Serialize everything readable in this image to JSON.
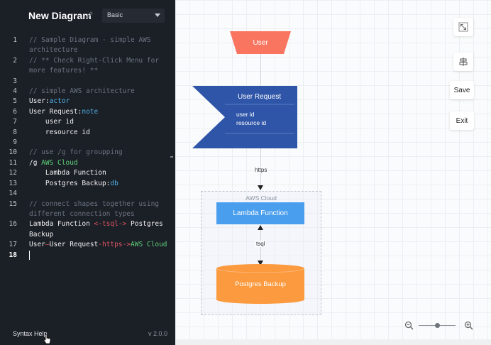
{
  "editor": {
    "title": "New Diagram",
    "theme_select": {
      "selected": "Basic"
    },
    "lines": [
      {
        "n": "1",
        "segments": [
          {
            "t": "// Sample Diagram - simple AWS",
            "c": "comment"
          }
        ]
      },
      {
        "n": "",
        "segments": [
          {
            "t": "architecture",
            "c": "comment"
          }
        ]
      },
      {
        "n": "2",
        "segments": [
          {
            "t": "// ** Check Right-Click Menu for",
            "c": "comment"
          }
        ]
      },
      {
        "n": "",
        "segments": [
          {
            "t": "more features! **",
            "c": "comment"
          }
        ]
      },
      {
        "n": "3",
        "segments": []
      },
      {
        "n": "4",
        "segments": [
          {
            "t": "// simple AWS architecture",
            "c": "comment"
          }
        ]
      },
      {
        "n": "5",
        "segments": [
          {
            "t": "User:",
            "c": ""
          },
          {
            "t": "actor",
            "c": "type"
          }
        ]
      },
      {
        "n": "6",
        "segments": [
          {
            "t": "User Request:",
            "c": ""
          },
          {
            "t": "note",
            "c": "type"
          }
        ]
      },
      {
        "n": "7",
        "segments": [
          {
            "t": "    user id",
            "c": ""
          }
        ]
      },
      {
        "n": "8",
        "segments": [
          {
            "t": "    resource id",
            "c": ""
          }
        ]
      },
      {
        "n": "9",
        "segments": []
      },
      {
        "n": "10",
        "segments": [
          {
            "t": "// use /g for groupping",
            "c": "comment"
          }
        ]
      },
      {
        "n": "11",
        "segments": [
          {
            "t": "/g ",
            "c": ""
          },
          {
            "t": "AWS Cloud",
            "c": "group"
          }
        ]
      },
      {
        "n": "12",
        "segments": [
          {
            "t": "    Lambda Function",
            "c": ""
          }
        ]
      },
      {
        "n": "13",
        "segments": [
          {
            "t": "    Postgres Backup:",
            "c": ""
          },
          {
            "t": "db",
            "c": "type"
          }
        ]
      },
      {
        "n": "14",
        "segments": []
      },
      {
        "n": "15",
        "segments": [
          {
            "t": "// connect shapes together using",
            "c": "comment"
          }
        ]
      },
      {
        "n": "",
        "segments": [
          {
            "t": "different connection types",
            "c": "comment"
          }
        ]
      },
      {
        "n": "16",
        "segments": [
          {
            "t": "Lambda Function ",
            "c": ""
          },
          {
            "t": "<-tsql->",
            "c": "arrow"
          },
          {
            "t": " Postgres",
            "c": ""
          }
        ]
      },
      {
        "n": "",
        "segments": [
          {
            "t": "Backup",
            "c": ""
          }
        ]
      },
      {
        "n": "17",
        "segments": [
          {
            "t": "User",
            "c": ""
          },
          {
            "t": "—",
            "c": "arrow"
          },
          {
            "t": "User Request",
            "c": ""
          },
          {
            "t": "-https->",
            "c": "arrow"
          },
          {
            "t": "AWS Cloud",
            "c": "group"
          }
        ]
      },
      {
        "n": "18",
        "segments": [],
        "active": true
      }
    ],
    "footer": {
      "syntax_help": "Syntax Help",
      "version": "v 2.0.0"
    }
  },
  "canvas": {
    "nodes": {
      "user": {
        "label": "User",
        "color": "#fa7560"
      },
      "user_request": {
        "title": "User Request",
        "fields": [
          "user id",
          "resource id"
        ],
        "color": "#2f55a8"
      },
      "lambda": {
        "label": "Lambda Function",
        "color": "#4a9eee"
      },
      "postgres": {
        "label": "Postgres Backup",
        "color": "#fb9a3e"
      }
    },
    "group": {
      "label": "AWS Cloud"
    },
    "edges": {
      "https_label": "https",
      "tsql_label": "tsql"
    },
    "toolbar": {
      "fit_icon": "expand-icon",
      "align_icon": "align-center-icon",
      "save": "Save",
      "exit": "Exit"
    },
    "zoom": {
      "level": 0.5
    }
  },
  "colors": {
    "editor_bg": "#1b1f26",
    "comment": "#6b7480",
    "type": "#4fb0e8",
    "group": "#5fd07a",
    "arrow": "#e05565"
  }
}
